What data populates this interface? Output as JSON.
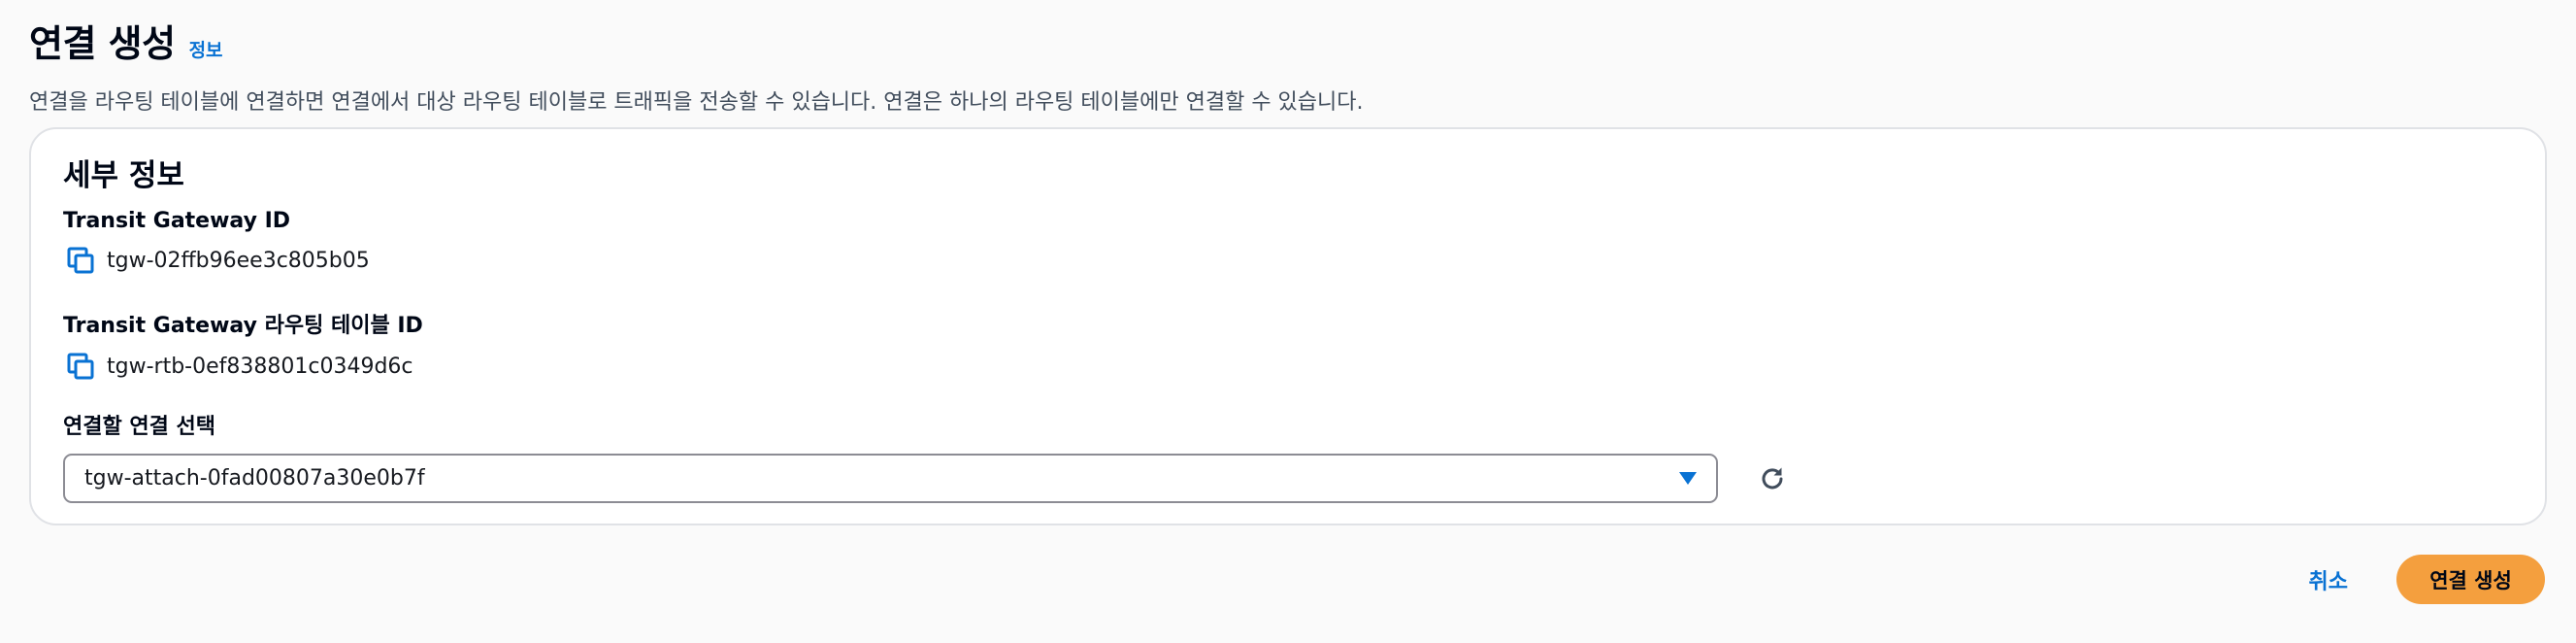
{
  "header": {
    "title": "연결 생성",
    "info_link": "정보",
    "description": "연결을 라우팅 테이블에 연결하면 연결에서 대상 라우팅 테이블로 트래픽을 전송할 수 있습니다. 연결은 하나의 라우팅 테이블에만 연결할 수 있습니다."
  },
  "details": {
    "title": "세부 정보",
    "transit_gateway": {
      "label": "Transit Gateway ID",
      "value": "tgw-02ffb96ee3c805b05",
      "icon": "copy-icon"
    },
    "route_table": {
      "label": "Transit Gateway 라우팅 테이블 ID",
      "value": "tgw-rtb-0ef838801c0349d6c",
      "icon": "copy-icon"
    },
    "attachment_select": {
      "label": "연결할 연결 선택",
      "selected": "tgw-attach-0fad00807a30e0b7f",
      "dropdown_icon": "caret-down-icon",
      "refresh_icon": "refresh-icon"
    }
  },
  "footer": {
    "cancel_label": "취소",
    "submit_label": "연결 생성"
  },
  "colors": {
    "link": "#0972d3",
    "primary_button": "#f49f3e",
    "background": "#fafafa",
    "card_border": "#e0e2e6"
  }
}
